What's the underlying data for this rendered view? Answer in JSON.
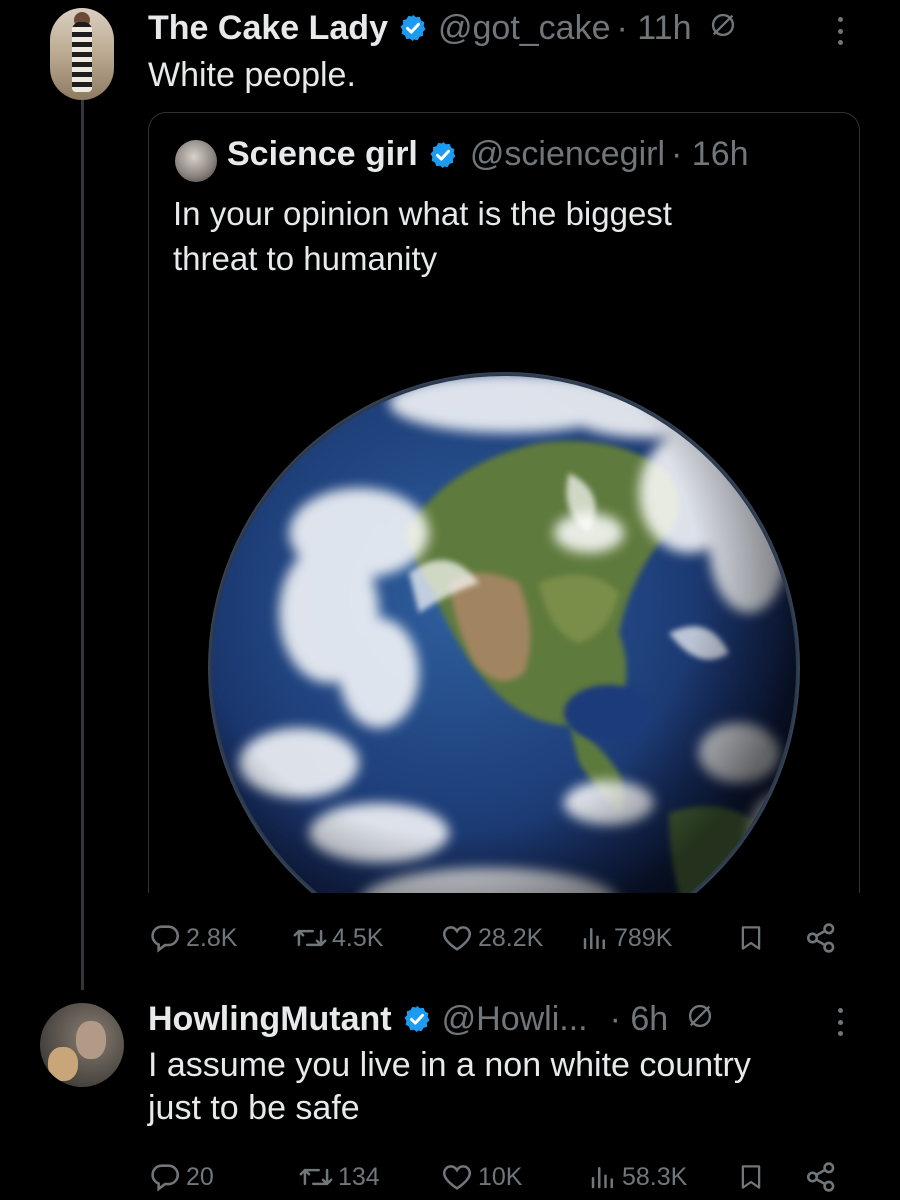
{
  "tweet1": {
    "name": "The Cake Lady",
    "handle": "@got_cake",
    "time": "· 11h",
    "text": "White people."
  },
  "quote": {
    "name": "Science girl",
    "handle": "@sciencegirl",
    "time": "· 16h",
    "text_line1": "In your opinion what is the biggest",
    "text_line2": "threat to humanity"
  },
  "actions1": {
    "replies": "2.8K",
    "reposts": "4.5K",
    "likes": "28.2K",
    "views": "789K"
  },
  "tweet2": {
    "name": "HowlingMutant",
    "handle": "@Howli...",
    "time": "· 6h",
    "text_line1": "I assume you live in a non white country",
    "text_line2": "just to be safe"
  },
  "actions2": {
    "replies": "20",
    "reposts": "134",
    "likes": "10K",
    "views": "58.3K"
  },
  "colors": {
    "background": "#000000",
    "text": "#e7e9ea",
    "muted": "#71767b",
    "verified": "#1d9bf0",
    "border": "#2f3336"
  },
  "icons": [
    "verified-badge-icon",
    "edit-history-icon",
    "more-icon",
    "reply-icon",
    "repost-icon",
    "like-icon",
    "views-icon",
    "bookmark-icon",
    "share-icon"
  ]
}
